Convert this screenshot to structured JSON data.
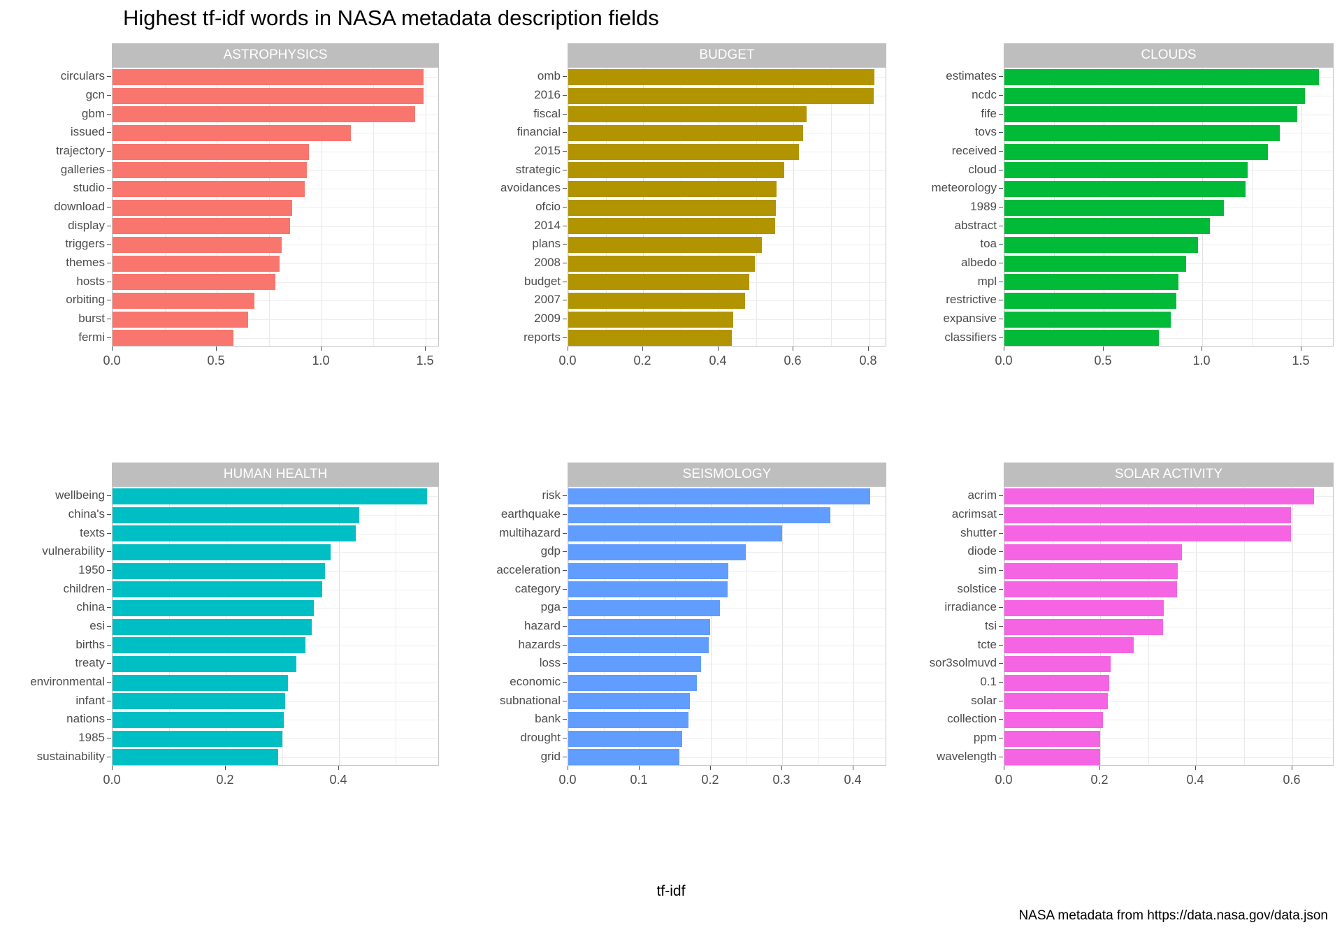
{
  "title": "Highest tf-idf words in NASA metadata description fields",
  "axis_title": "tf-idf",
  "caption": "NASA metadata from https://data.nasa.gov/data.json",
  "chart_data": {
    "type": "bar",
    "title": "Highest tf-idf words in NASA metadata description fields",
    "xlabel": "tf-idf",
    "ylabel": "",
    "orientation": "horizontal",
    "grid": true,
    "legend": "none",
    "caption": "NASA metadata from https://data.nasa.gov/data.json",
    "facets": [
      {
        "name": "ASTROPHYSICS",
        "color": "#F8766D",
        "xlim": [
          0,
          1.56
        ],
        "xticks": [
          0.0,
          0.5,
          1.0,
          1.5
        ],
        "xticklabels": [
          "0.0",
          "0.5",
          "1.0",
          "1.5"
        ],
        "categories": [
          "circulars",
          "gcn",
          "gbm",
          "issued",
          "trajectory",
          "galleries",
          "studio",
          "download",
          "display",
          "triggers",
          "themes",
          "hosts",
          "orbiting",
          "burst",
          "fermi"
        ],
        "values": [
          1.49,
          1.49,
          1.45,
          1.14,
          0.94,
          0.93,
          0.92,
          0.86,
          0.85,
          0.81,
          0.8,
          0.78,
          0.68,
          0.65,
          0.58
        ]
      },
      {
        "name": "BUDGET",
        "color": "#B29400",
        "xlim": [
          0,
          0.845
        ],
        "xticks": [
          0.0,
          0.2,
          0.4,
          0.6,
          0.8
        ],
        "xticklabels": [
          "0.0",
          "0.2",
          "0.4",
          "0.6",
          "0.8"
        ],
        "categories": [
          "omb",
          "2016",
          "fiscal",
          "financial",
          "2015",
          "strategic",
          "avoidances",
          "ofcio",
          "2014",
          "plans",
          "2008",
          "budget",
          "2007",
          "2009",
          "reports"
        ],
        "values": [
          0.815,
          0.813,
          0.635,
          0.625,
          0.615,
          0.575,
          0.555,
          0.553,
          0.551,
          0.515,
          0.497,
          0.482,
          0.47,
          0.44,
          0.436
        ]
      },
      {
        "name": "CLOUDS",
        "color": "#00BA38",
        "xlim": [
          0,
          1.66
        ],
        "xticks": [
          0.0,
          0.5,
          1.0,
          1.5
        ],
        "xticklabels": [
          "0.0",
          "0.5",
          "1.0",
          "1.5"
        ],
        "categories": [
          "estimates",
          "ncdc",
          "fife",
          "tovs",
          "received",
          "cloud",
          "meteorology",
          "1989",
          "abstract",
          "toa",
          "albedo",
          "mpl",
          "restrictive",
          "expansive",
          "classifiers"
        ],
        "values": [
          1.59,
          1.52,
          1.48,
          1.39,
          1.33,
          1.23,
          1.22,
          1.11,
          1.04,
          0.98,
          0.92,
          0.88,
          0.87,
          0.84,
          0.78
        ]
      },
      {
        "name": "HUMAN HEALTH",
        "color": "#00BFC4",
        "xlim": [
          0,
          0.575
        ],
        "xticks": [
          0.0,
          0.2,
          0.4
        ],
        "xticklabels": [
          "0.0",
          "0.2",
          "0.4"
        ],
        "categories": [
          "wellbeing",
          "china's",
          "texts",
          "vulnerability",
          "1950",
          "children",
          "china",
          "esi",
          "births",
          "treaty",
          "environmental",
          "infant",
          "nations",
          "1985",
          "sustainability"
        ],
        "values": [
          0.555,
          0.435,
          0.43,
          0.385,
          0.375,
          0.37,
          0.355,
          0.352,
          0.34,
          0.325,
          0.31,
          0.305,
          0.302,
          0.3,
          0.292
        ]
      },
      {
        "name": "SEISMOLOGY",
        "color": "#619CFF",
        "xlim": [
          0,
          0.445
        ],
        "xticks": [
          0.0,
          0.1,
          0.2,
          0.3,
          0.4
        ],
        "xticklabels": [
          "0.0",
          "0.1",
          "0.2",
          "0.3",
          "0.4"
        ],
        "categories": [
          "risk",
          "earthquake",
          "multihazard",
          "gdp",
          "acceleration",
          "category",
          "pga",
          "hazard",
          "hazards",
          "loss",
          "economic",
          "subnational",
          "bank",
          "drought",
          "grid"
        ],
        "values": [
          0.423,
          0.368,
          0.3,
          0.249,
          0.224,
          0.223,
          0.213,
          0.199,
          0.197,
          0.186,
          0.18,
          0.171,
          0.169,
          0.16,
          0.156
        ]
      },
      {
        "name": "SOLAR ACTIVITY",
        "color": "#F564E3",
        "xlim": [
          0,
          0.685
        ],
        "xticks": [
          0.0,
          0.2,
          0.4,
          0.6
        ],
        "xticklabels": [
          "0.0",
          "0.2",
          "0.4",
          "0.6"
        ],
        "categories": [
          "acrim",
          "acrimsat",
          "shutter",
          "diode",
          "sim",
          "solstice",
          "irradiance",
          "tsi",
          "tcte",
          "sor3solmuvd",
          "0.1",
          "solar",
          "collection",
          "ppm",
          "wavelength"
        ],
        "values": [
          0.645,
          0.598,
          0.597,
          0.37,
          0.362,
          0.36,
          0.332,
          0.331,
          0.27,
          0.222,
          0.218,
          0.215,
          0.206,
          0.2,
          0.199
        ]
      }
    ]
  }
}
